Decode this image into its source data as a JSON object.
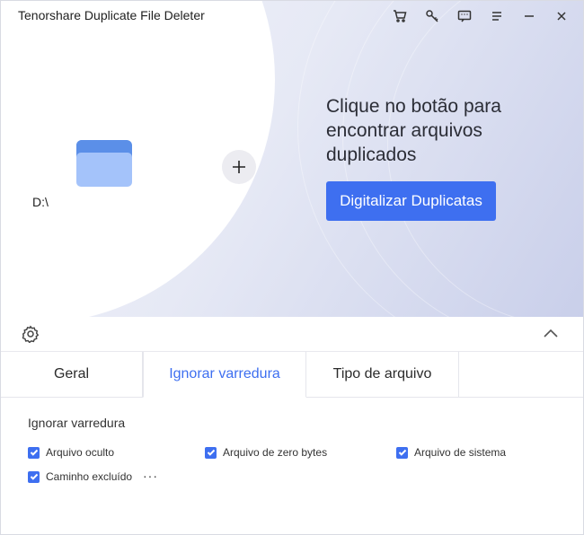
{
  "app": {
    "title": "Tenorshare Duplicate File Deleter"
  },
  "titlebar": {
    "icons": [
      "cart-icon",
      "key-icon",
      "feedback-icon",
      "menu-icon",
      "minimize-icon",
      "close-icon"
    ]
  },
  "hero": {
    "drive": "D:\\",
    "message": "Clique no botão para encontrar arquivos duplicados",
    "scan_button": "Digitalizar Duplicatas"
  },
  "tabs": [
    {
      "label": "Geral",
      "active": false
    },
    {
      "label": "Ignorar varredura",
      "active": true
    },
    {
      "label": "Tipo de arquivo",
      "active": false
    }
  ],
  "ignore_scan": {
    "title": "Ignorar varredura",
    "options": [
      {
        "label": "Arquivo oculto",
        "checked": true
      },
      {
        "label": "Arquivo de zero bytes",
        "checked": true
      },
      {
        "label": "Arquivo de sistema",
        "checked": true
      },
      {
        "label": "Caminho excluído",
        "checked": true
      }
    ],
    "more": "···"
  },
  "colors": {
    "accent": "#3e6ff0",
    "folder_dark": "#5b8fe8",
    "folder_light": "#a4c3fa"
  }
}
